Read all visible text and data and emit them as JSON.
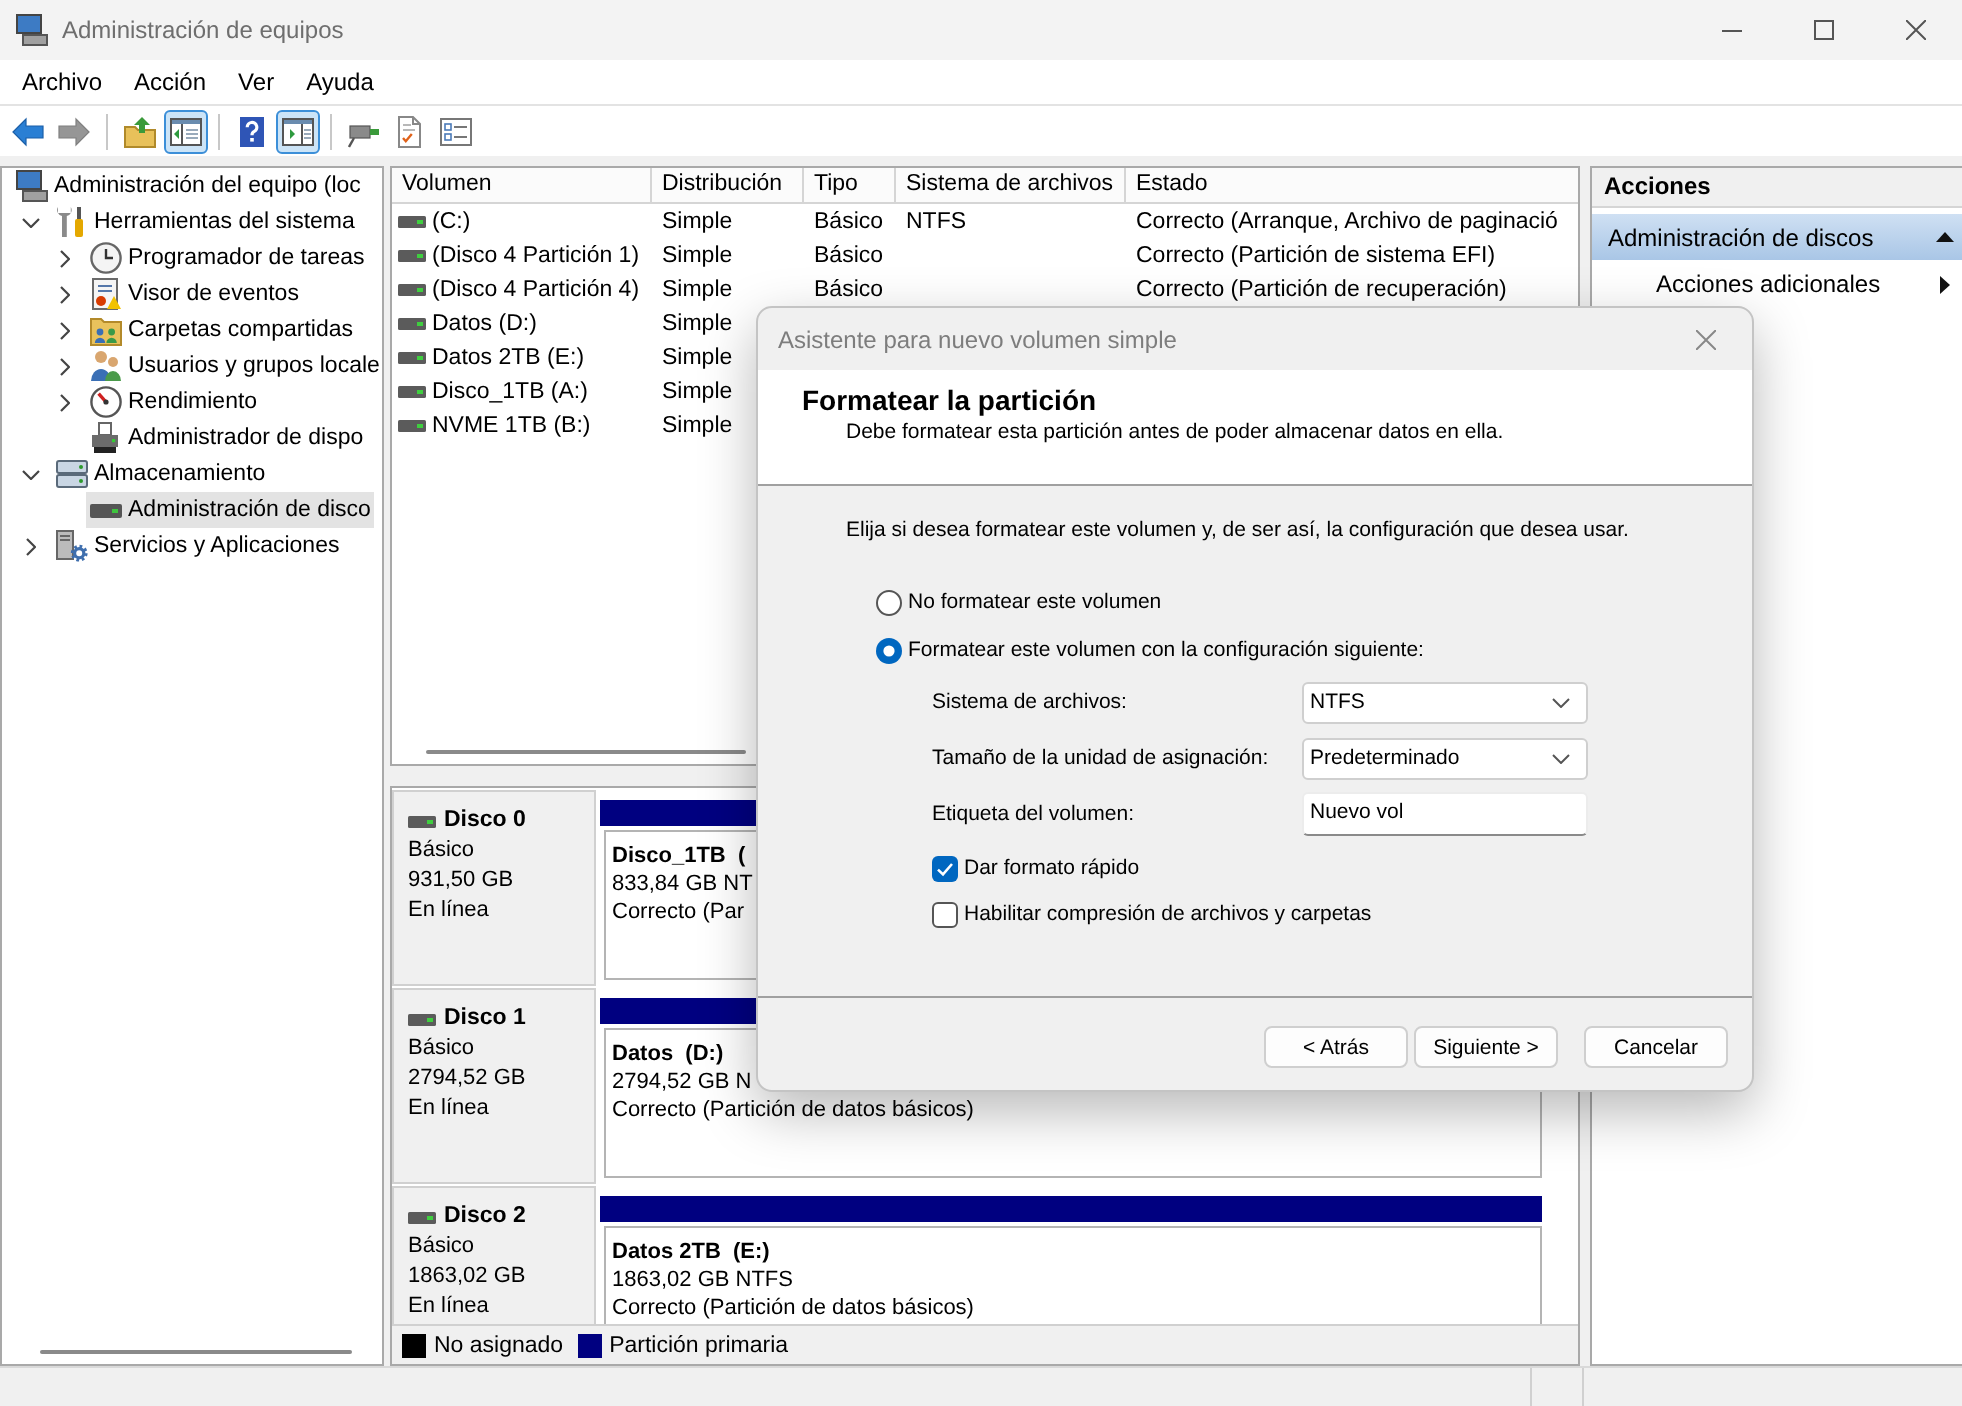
{
  "window": {
    "title": "Administración de equipos"
  },
  "menu": [
    {
      "label": "Archivo"
    },
    {
      "label": "Acción"
    },
    {
      "label": "Ver"
    },
    {
      "label": "Ayuda"
    }
  ],
  "toolbar": [
    [
      {
        "kind": "back",
        "disabled": false
      },
      {
        "kind": "forward",
        "disabled": true
      }
    ],
    [
      {
        "kind": "up",
        "disabled": false
      },
      {
        "kind": "console-tree",
        "disabled": false,
        "pressed": true
      }
    ],
    [
      {
        "kind": "help",
        "disabled": false
      },
      {
        "kind": "action-pane",
        "disabled": false,
        "pressed": true
      }
    ],
    [
      {
        "kind": "connect",
        "disabled": false
      },
      {
        "kind": "checklist",
        "disabled": false
      },
      {
        "kind": "properties",
        "disabled": false
      }
    ]
  ],
  "tree": [
    {
      "label": "Administración del equipo (loc",
      "kind": "computer",
      "selected": false,
      "children": [
        {
          "label": "Herramientas del sistema",
          "kind": "tools",
          "expanded": true,
          "selected": false,
          "children": [
            {
              "label": "Programador de tareas",
              "kind": "clock",
              "expanded": false,
              "selected": false
            },
            {
              "label": "Visor de eventos",
              "kind": "event-log",
              "expanded": false,
              "selected": false
            },
            {
              "label": "Carpetas compartidas",
              "kind": "shared-folder",
              "expanded": false,
              "selected": false
            },
            {
              "label": "Usuarios y grupos locale",
              "kind": "users",
              "expanded": false,
              "selected": false
            },
            {
              "label": "Rendimiento",
              "kind": "performance",
              "expanded": false,
              "selected": false
            },
            {
              "label": "Administrador de dispo",
              "kind": "device",
              "selected": false
            }
          ]
        },
        {
          "label": "Almacenamiento",
          "kind": "storage",
          "expanded": true,
          "selected": false,
          "children": [
            {
              "label": "Administración de disco",
              "kind": "disk",
              "selected": true
            }
          ]
        },
        {
          "label": "Servicios y Aplicaciones",
          "kind": "services",
          "expanded": false,
          "selected": false
        }
      ]
    }
  ],
  "volumes": {
    "columns": [
      "Volumen",
      "Distribución",
      "Tipo",
      "Sistema de archivos",
      "Estado"
    ],
    "rows": [
      {
        "volume": "(C:)",
        "layout": "Simple",
        "type": "Básico",
        "file_system": "NTFS",
        "status": "Correcto (Arranque, Archivo de paginació"
      },
      {
        "volume": "(Disco 4 Partición 1)",
        "layout": "Simple",
        "type": "Básico",
        "status": "Correcto (Partición de sistema EFI)"
      },
      {
        "volume": "(Disco 4 Partición 4)",
        "layout": "Simple",
        "type": "Básico",
        "status": "Correcto (Partición de recuperación)"
      },
      {
        "volume": "Datos (D:)",
        "layout": "Simple"
      },
      {
        "volume": "Datos 2TB (E:)",
        "layout": "Simple"
      },
      {
        "volume": "Disco_1TB (A:)",
        "layout": "Simple"
      },
      {
        "volume": "NVME 1TB (B:)",
        "layout": "Simple"
      }
    ]
  },
  "disks": [
    {
      "name": "Disco 0",
      "type": "Básico",
      "size": "931,50 GB",
      "status": "En línea",
      "partitions": [
        {
          "name": "Disco_1TB  (",
          "color": "#000080",
          "details": [
            "833,84 GB NT",
            "Correcto (Par"
          ]
        }
      ]
    },
    {
      "name": "Disco 1",
      "type": "Básico",
      "size": "2794,52 GB",
      "status": "En línea",
      "partitions": [
        {
          "name": "Datos  (D:)",
          "color": "#000080",
          "details": [
            "2794,52 GB N",
            "Correcto (Partición de datos básicos)"
          ]
        }
      ]
    },
    {
      "name": "Disco 2",
      "type": "Básico",
      "size": "1863,02 GB",
      "status": "En línea",
      "partitions": [
        {
          "name": "Datos 2TB  (E:)",
          "color": "#000080",
          "details": [
            "1863,02 GB NTFS",
            "Correcto (Partición de datos básicos)"
          ]
        }
      ]
    }
  ],
  "legend": [
    {
      "label": "No asignado",
      "color": "#000000"
    },
    {
      "label": "Partición primaria",
      "color": "#000080"
    }
  ],
  "actions": {
    "title": "Acciones",
    "sections": [
      {
        "label": "Administración de discos",
        "expanded": true,
        "items": [
          {
            "label": "Acciones adicionales"
          }
        ]
      }
    ]
  },
  "dialog": {
    "title": "Asistente para nuevo volumen simple",
    "heading": "Formatear la partición",
    "subtitle": "Debe formatear esta partición antes de poder almacenar datos en ella.",
    "intro": "Elija si desea formatear este volumen y, de ser así, la configuración que desea usar.",
    "options": [
      {
        "label": "No formatear este volumen",
        "selected": false
      },
      {
        "label": "Formatear este volumen con la configuración siguiente:",
        "selected": true
      }
    ],
    "fields": [
      {
        "label": "Sistema de archivos:",
        "kind": "select",
        "value": "NTFS"
      },
      {
        "label": "Tamaño de la unidad de asignación:",
        "kind": "select",
        "value": "Predeterminado"
      },
      {
        "label": "Etiqueta del volumen:",
        "kind": "text",
        "value": "Nuevo vol"
      }
    ],
    "checks": [
      {
        "label": "Dar formato rápido",
        "checked": true
      },
      {
        "label": "Habilitar compresión de archivos y carpetas",
        "checked": false
      }
    ],
    "buttons": [
      "< Atrás",
      "Siguiente >",
      "Cancelar"
    ]
  }
}
